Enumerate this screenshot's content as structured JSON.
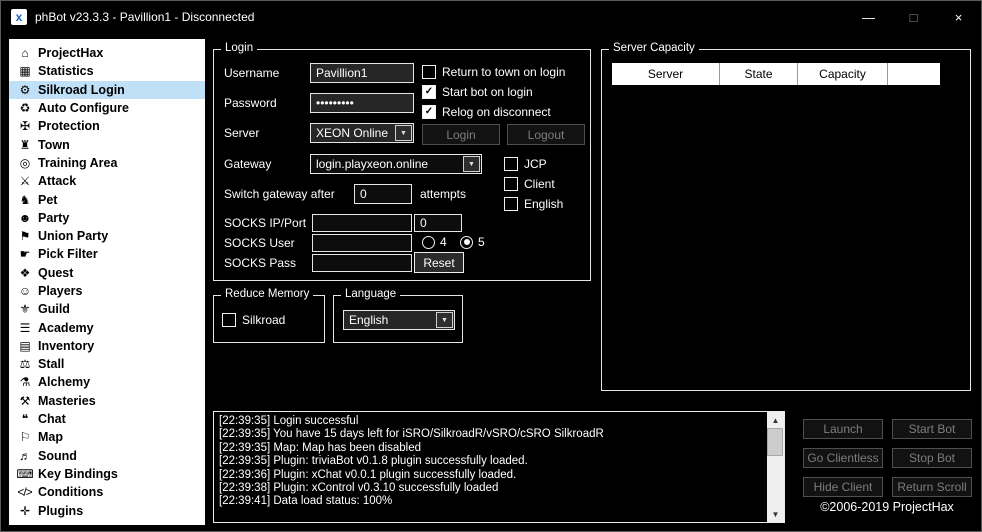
{
  "window": {
    "title": "phBot v23.3.3 - Pavillion1 - Disconnected",
    "app_icon_glyph": "x",
    "controls": {
      "minimize": "—",
      "maximize": "□",
      "close": "×"
    }
  },
  "colors": {
    "selection": "#bfe0f7",
    "background": "#000000",
    "sidebar_background": "#ffffff",
    "groupbox_border": "#e6e6e6",
    "disabled_button_text": "#7d7d7d"
  },
  "icons": {
    "dropdown": "▼",
    "scroll_up": "▲",
    "scroll_down": "▼"
  },
  "sidebar": {
    "items": [
      {
        "name": "sidebar-item-projecthax",
        "label": "ProjectHax",
        "icon": "⌂",
        "icon_name": "projecthax-icon",
        "selected": false
      },
      {
        "name": "sidebar-item-statistics",
        "label": "Statistics",
        "icon": "▦",
        "icon_name": "statistics-icon",
        "selected": false
      },
      {
        "name": "sidebar-item-silkroad-login",
        "label": "Silkroad Login",
        "icon": "⚙",
        "icon_name": "silkroad-login-icon",
        "selected": true
      },
      {
        "name": "sidebar-item-auto-configure",
        "label": "Auto Configure",
        "icon": "♻",
        "icon_name": "auto-configure-icon",
        "selected": false
      },
      {
        "name": "sidebar-item-protection",
        "label": "Protection",
        "icon": "✠",
        "icon_name": "protection-icon",
        "selected": false
      },
      {
        "name": "sidebar-item-town",
        "label": "Town",
        "icon": "♜",
        "icon_name": "town-icon",
        "selected": false
      },
      {
        "name": "sidebar-item-training-area",
        "label": "Training Area",
        "icon": "◎",
        "icon_name": "training-area-icon",
        "selected": false
      },
      {
        "name": "sidebar-item-attack",
        "label": "Attack",
        "icon": "⚔",
        "icon_name": "attack-icon",
        "selected": false
      },
      {
        "name": "sidebar-item-pet",
        "label": "Pet",
        "icon": "♞",
        "icon_name": "pet-icon",
        "selected": false
      },
      {
        "name": "sidebar-item-party",
        "label": "Party",
        "icon": "☻",
        "icon_name": "party-icon",
        "selected": false
      },
      {
        "name": "sidebar-item-union-party",
        "label": "Union Party",
        "icon": "⚑",
        "icon_name": "union-party-icon",
        "selected": false
      },
      {
        "name": "sidebar-item-pick-filter",
        "label": "Pick Filter",
        "icon": "☛",
        "icon_name": "pick-filter-icon",
        "selected": false
      },
      {
        "name": "sidebar-item-quest",
        "label": "Quest",
        "icon": "❖",
        "icon_name": "quest-icon",
        "selected": false
      },
      {
        "name": "sidebar-item-players",
        "label": "Players",
        "icon": "☺",
        "icon_name": "players-icon",
        "selected": false
      },
      {
        "name": "sidebar-item-guild",
        "label": "Guild",
        "icon": "⚜",
        "icon_name": "guild-icon",
        "selected": false
      },
      {
        "name": "sidebar-item-academy",
        "label": "Academy",
        "icon": "☰",
        "icon_name": "academy-icon",
        "selected": false
      },
      {
        "name": "sidebar-item-inventory",
        "label": "Inventory",
        "icon": "▤",
        "icon_name": "inventory-icon",
        "selected": false
      },
      {
        "name": "sidebar-item-stall",
        "label": "Stall",
        "icon": "⚖",
        "icon_name": "stall-icon",
        "selected": false
      },
      {
        "name": "sidebar-item-alchemy",
        "label": "Alchemy",
        "icon": "⚗",
        "icon_name": "alchemy-icon",
        "selected": false
      },
      {
        "name": "sidebar-item-masteries",
        "label": "Masteries",
        "icon": "⚒",
        "icon_name": "masteries-icon",
        "selected": false
      },
      {
        "name": "sidebar-item-chat",
        "label": "Chat",
        "icon": "❝",
        "icon_name": "chat-icon",
        "selected": false
      },
      {
        "name": "sidebar-item-map",
        "label": "Map",
        "icon": "⚐",
        "icon_name": "map-icon",
        "selected": false
      },
      {
        "name": "sidebar-item-sound",
        "label": "Sound",
        "icon": "♬",
        "icon_name": "sound-icon",
        "selected": false
      },
      {
        "name": "sidebar-item-key-bindings",
        "label": "Key Bindings",
        "icon": "⌨",
        "icon_name": "key-bindings-icon",
        "selected": false
      },
      {
        "name": "sidebar-item-conditions",
        "label": "Conditions",
        "icon": "</>",
        "icon_name": "conditions-icon",
        "selected": false
      },
      {
        "name": "sidebar-item-plugins",
        "label": "Plugins",
        "icon": "✛",
        "icon_name": "plugins-icon",
        "selected": false
      }
    ]
  },
  "login": {
    "title": "Login",
    "username_label": "Username",
    "username_value": "Pavillion1",
    "password_label": "Password",
    "password_value": "•••••••••",
    "server_label": "Server",
    "server_value": "XEON Online",
    "gateway_label": "Gateway",
    "gateway_value": "login.playxeon.online",
    "switch_label": "Switch gateway after",
    "switch_value": "0",
    "switch_suffix": "attempts",
    "socks_ip_label": "SOCKS IP/Port",
    "socks_ip_value": "",
    "socks_port_value": "0",
    "socks_user_label": "SOCKS User",
    "socks_user_value": "",
    "socks_pass_label": "SOCKS Pass",
    "socks_pass_value": "",
    "login_button": "Login",
    "logout_button": "Logout",
    "reset_button": "Reset",
    "checkboxes": [
      {
        "label": "Return to town on login",
        "checked": false
      },
      {
        "label": "Start bot on login",
        "checked": true
      },
      {
        "label": "Relog on disconnect",
        "checked": true
      }
    ],
    "side_checkboxes": [
      {
        "label": "JCP",
        "checked": false
      },
      {
        "label": "Client",
        "checked": false
      },
      {
        "label": "English",
        "checked": false
      }
    ],
    "socks_version_radios": [
      {
        "label": "4",
        "selected": false
      },
      {
        "label": "5",
        "selected": true
      }
    ]
  },
  "reduce_memory": {
    "title": "Reduce Memory",
    "checkbox_label": "Silkroad",
    "checked": false
  },
  "language": {
    "title": "Language",
    "selected": "English"
  },
  "server_capacity": {
    "title": "Server Capacity",
    "columns": [
      "Server",
      "State",
      "Capacity"
    ],
    "rows": []
  },
  "log": {
    "lines": [
      "[22:39:35] Login successful",
      "[22:39:35] You have 15 days left for iSRO/SilkroadR/vSRO/cSRO SilkroadR",
      "[22:39:35] Map: Map has been disabled",
      "[22:39:35] Plugin: triviaBot v0.1.8 plugin successfully loaded.",
      "[22:39:36] Plugin: xChat v0.0.1 plugin successfully loaded.",
      "[22:39:38] Plugin: xControl v0.3.10 successfully loaded",
      "[22:39:41] Data load status: 100%"
    ]
  },
  "actions": {
    "launch": "Launch",
    "start_bot": "Start Bot",
    "go_clientless": "Go Clientless",
    "stop_bot": "Stop Bot",
    "hide_client": "Hide Client",
    "return_scroll": "Return Scroll"
  },
  "footer": {
    "copyright": "©2006-2019 ProjectHax"
  }
}
